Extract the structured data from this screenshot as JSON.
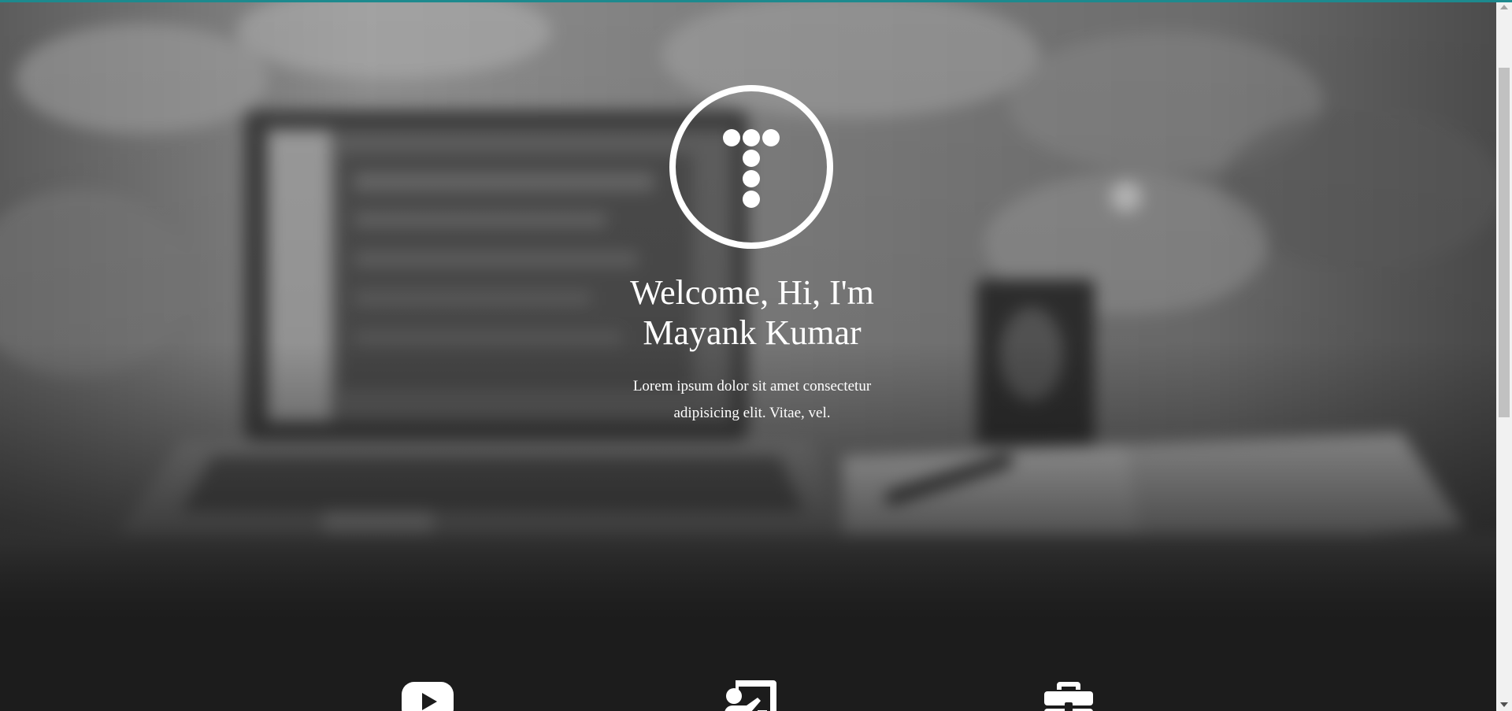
{
  "hero": {
    "title_line1": "Welcome, Hi, I'm",
    "title_line2": "Mayank Kumar",
    "text_line1": "Lorem ipsum dolor sit amet consectetur",
    "text_line2": "adipisicing elit. Vitae, vel.",
    "logo_icon": "dotted-t-logo-icon",
    "background_scene": "blurred-desk-laptop-image"
  },
  "services": {
    "icons": [
      "youtube-icon",
      "teacher-board-icon",
      "briefcase-icon"
    ]
  },
  "colors": {
    "accent": "#1d8a8e",
    "dark_bg": "#1c1c1c",
    "text": "#ffffff"
  }
}
